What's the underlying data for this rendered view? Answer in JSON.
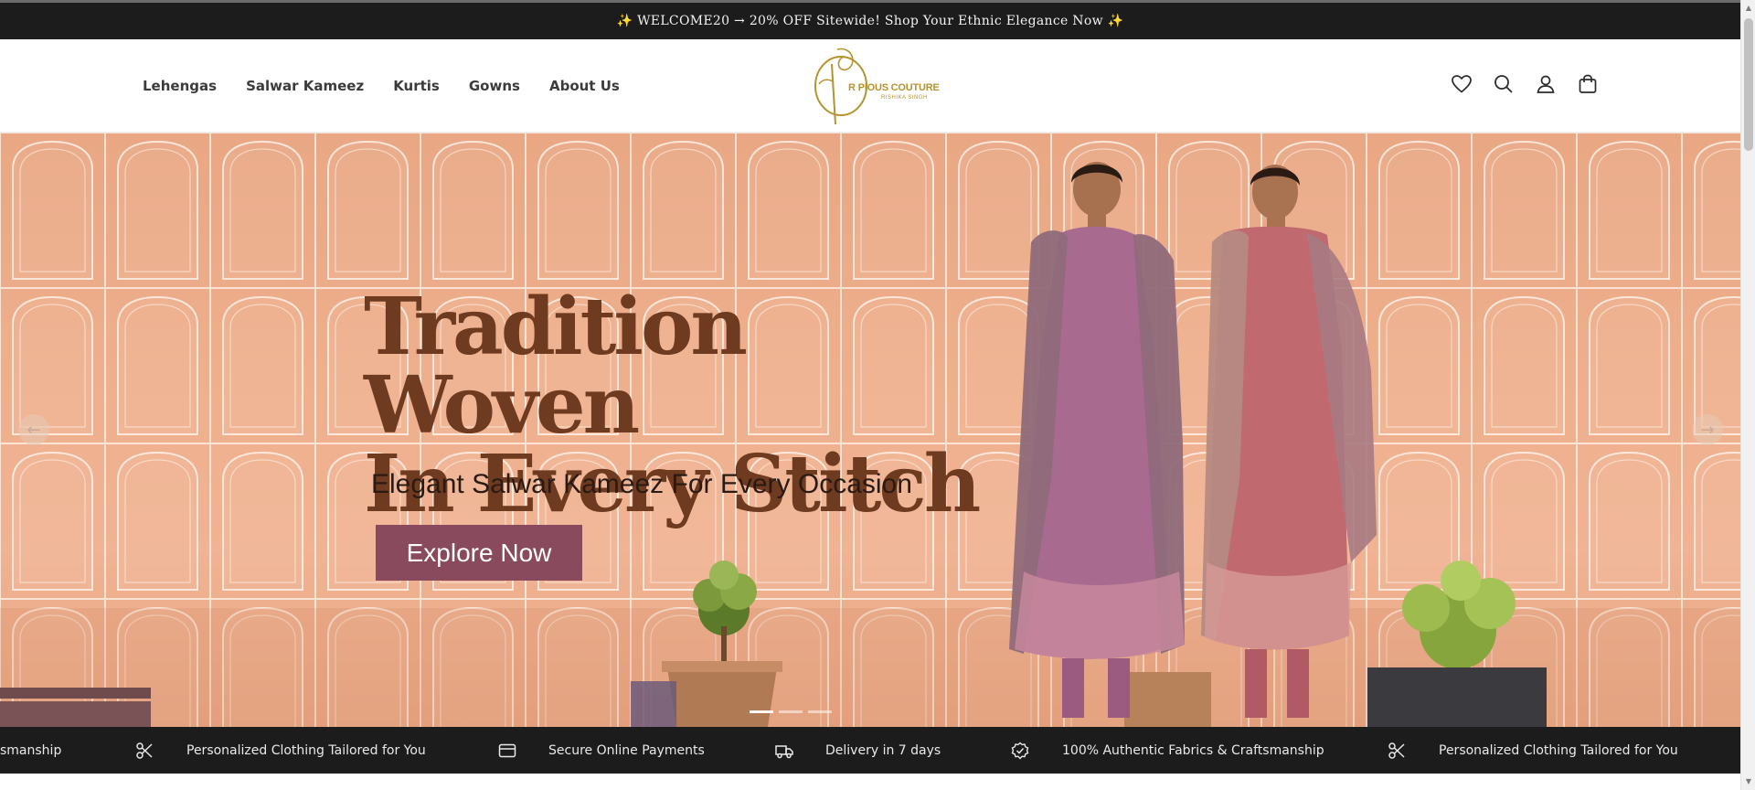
{
  "announcement": "✨ WELCOME20 → 20% OFF Sitewide! Shop Your Ethnic Elegance Now ✨",
  "nav": [
    "Lehengas",
    "Salwar Kameez",
    "Kurtis",
    "Gowns",
    "About Us"
  ],
  "logo": {
    "brand": "R PIOUS COUTURE",
    "tagline": "RISHIKA SINGH",
    "color": "#b39430"
  },
  "header_icons": [
    "heart-icon",
    "search-icon",
    "account-icon",
    "cart-icon"
  ],
  "hero": {
    "title_line_1": "Tradition Woven",
    "title_line_2": "In Every Stitch",
    "subtitle": "Elegant Salwar Kameez For Every Occasion",
    "cta_label": "Explore Now",
    "prev_arrow": "←",
    "next_arrow": "→",
    "accent_color": "#8a4a5e"
  },
  "features": [
    {
      "label": "smanship",
      "icon": "badge-check-icon"
    },
    {
      "label": "Personalized Clothing Tailored for You",
      "icon": "scissors-icon"
    },
    {
      "label": "Secure Online Payments",
      "icon": "credit-card-icon"
    },
    {
      "label": "Delivery in 7 days",
      "icon": "truck-icon"
    },
    {
      "label": "100% Authentic Fabrics & Craftsmanship",
      "icon": "badge-check-icon"
    },
    {
      "label": "Personalized Clothing Tailored for You",
      "icon": "scissors-icon"
    }
  ]
}
